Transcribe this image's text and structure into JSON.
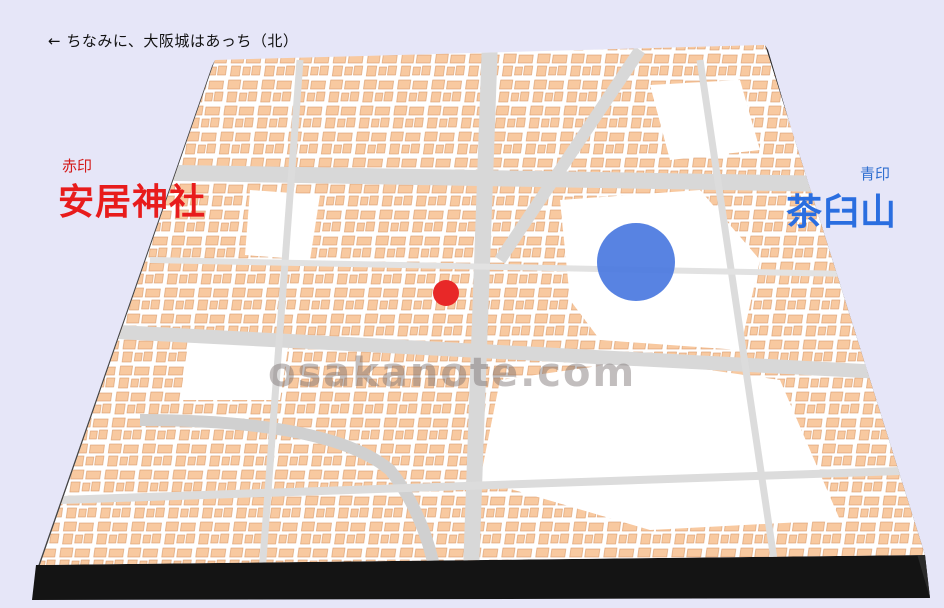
{
  "header": {
    "north_note": "← ちなみに、大阪城はあっち（北）"
  },
  "legend": {
    "red": {
      "small_label": "赤印",
      "name": "安居神社",
      "color": "#e81c1c"
    },
    "blue": {
      "small_label": "青印",
      "name": "茶臼山",
      "color": "#2a6ee0"
    }
  },
  "watermark": "osakanote.com",
  "colors": {
    "background": "#e6e6f8",
    "map_base": "#ffffff",
    "building": "#f8c9a0",
    "building_edge": "#d99a6a",
    "road": "#cfcfcf",
    "base_side": "#141414"
  }
}
